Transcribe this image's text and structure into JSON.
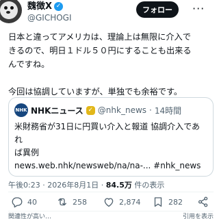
{
  "user": {
    "display_name": "魏徴X",
    "handle": "@GICHOGI",
    "verified_icon": "verified-check-icon",
    "follow_label": "フォロー",
    "more_label": "···"
  },
  "post": {
    "text": "日本と違ってアメリカは、理論上は無限に介入で\nきるので、明日１ドル５０円にすることも出来る\nんですね。\n\n今回は協調していますが、単独でも余裕です。"
  },
  "quote": {
    "logo_text": "NHK",
    "name": "NHKニュース",
    "handle": "@nhk_news",
    "separator": "·",
    "time": "14時間",
    "text": "米財務省が31日に円買い介入と報道 協調介入であれ\nば異例\nnews.web.nhk/newsweb/na/na-... #nhk_news"
  },
  "meta": {
    "time": "午後0:23",
    "sep1": "·",
    "date": "2026年8月1日",
    "sep2": "·",
    "views": "84.5万",
    "views_suffix": "件の表示"
  },
  "actions": {
    "replies": "40",
    "reposts": "258",
    "likes": "2,874",
    "bookmarks": "282"
  },
  "footer": {
    "left": "関連性が高い…",
    "right": "引用を表示"
  },
  "colors": {
    "text": "#0f1419",
    "secondary": "#536471",
    "verified": "#1d9bf0",
    "nhk_blue": "#16467e",
    "gold_check": "#e2b719",
    "border": "#cfd9de"
  }
}
